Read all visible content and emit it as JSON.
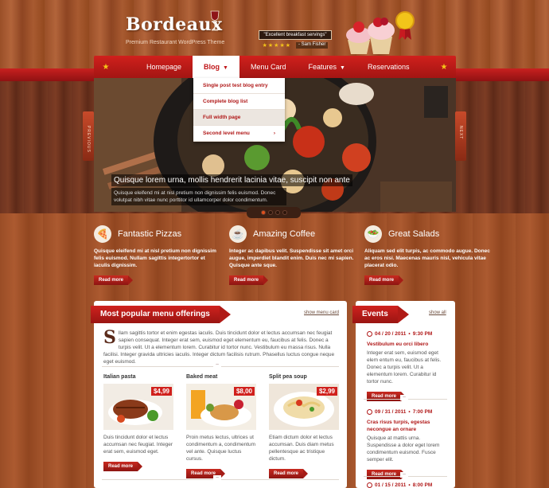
{
  "brand": {
    "title": "Bordeaux",
    "subtitle": "Premium Restaurant WordPress Theme"
  },
  "testimonial": {
    "quote": "\"Excellent breakfast servings\"",
    "stars": "★★★★★",
    "author": "- Sam Fisher"
  },
  "nav": {
    "items": [
      {
        "label": "Homepage"
      },
      {
        "label": "Blog"
      },
      {
        "label": "Menu Card"
      },
      {
        "label": "Features"
      },
      {
        "label": "Reservations"
      }
    ]
  },
  "dropdown": {
    "items": [
      {
        "label": "Single post test blog entry"
      },
      {
        "label": "Complete blog list"
      },
      {
        "label": "Full width page"
      },
      {
        "label": "Second level menu",
        "arrow": "›"
      }
    ]
  },
  "slider": {
    "title": "Quisque lorem urna, mollis hendrerit lacinia vitae, suscipit non ante",
    "text": "Quisque eleifend mi at nisl pretium non dignissim felis euismod. Donec volutpat nibh vitae nunc porttitor id ullamcorper dolor condimentum.",
    "prev_label": "PREVIOUS",
    "next_label": "NEXT",
    "slide_count": 4,
    "active_slide": 1
  },
  "features": [
    {
      "title": "Fantastic Pizzas",
      "icon": "pizza-icon",
      "text": "Quisque eleifend mi at nisl pretium non dignissim felis euismod. Nullam sagittis integertortor et iaculis dignissim.",
      "button": "Read more"
    },
    {
      "title": "Amazing Coffee",
      "icon": "coffee-icon",
      "text": "Integer ac dapibus velit. Suspendisse sit amet orci augue, imperdiet blandit enim. Duis nec mi sapien. Quisque ante sque.",
      "button": "Read more"
    },
    {
      "title": "Great Salads",
      "icon": "salad-icon",
      "text": "Aliquam sed elit turpis, ac commodo augue. Donec ac eros nisi. Maecenas mauris nisl, vehicula vitae placerat odio.",
      "button": "Read more"
    }
  ],
  "menu_panel": {
    "title": "Most popular menu offerings",
    "link": "show menu card",
    "dropcap": "S",
    "intro": "llam sagittis tortor et enim egestas iaculis. Duis tincidunt dolor et lectus accumsan nec feugiat sapien consequat. Integer erat sem, euismod eget elementum eu, faucibus at felis. Donec a turpis velit. Ut a elementum lorem. Curabitur id tortor nunc. Vestibulum eu massa risus. Nulla facilisi. Integer gravida ultricies iaculis. Integer dictum facilisis rutrum. Phasellus luctus congue neque eget euismod.",
    "dishes": [
      {
        "name": "Italian pasta",
        "price": "$4,99",
        "text": "Duis tincidunt dolor et lectus accumsan nec feugiat. Integer erat sem, euismod eget.",
        "button": "Read more"
      },
      {
        "name": "Baked meat",
        "price": "$8,00",
        "text": "Proin metus lectus, ultrices ut condimentum a, condimentum vel ante. Quisque luctus cursus.",
        "button": "Read more"
      },
      {
        "name": "Split pea soup",
        "price": "$2,99",
        "text": "Etiam dictum dolor et lectus accumsan. Duis diam metus pellentesque ac tristique dictum.",
        "button": "Read more"
      }
    ]
  },
  "events_panel": {
    "title": "Events",
    "link": "show all",
    "events": [
      {
        "date": "04 / 20 / 2011",
        "time": "9:30 PM",
        "title": "Vestibulum eu orci libero",
        "text": "Integer erat sem, euismod eget elem entum eu, faucibus at felis. Donec a turpis velit. Ut a elementum lorem. Curabitur id tortor nunc.",
        "button": "Read more"
      },
      {
        "date": "09 / 31 / 2011",
        "time": "7:00 PM",
        "title": "Cras risus turpis, egestas necongue an ornare",
        "text": "Quisque at mattis urna. Suspendisse a dolor eget lorem condimentum euismod. Fusce semper elit.",
        "button": "Read more"
      },
      {
        "date": "01 / 15 / 2011",
        "time": "8:00 PM"
      }
    ]
  }
}
